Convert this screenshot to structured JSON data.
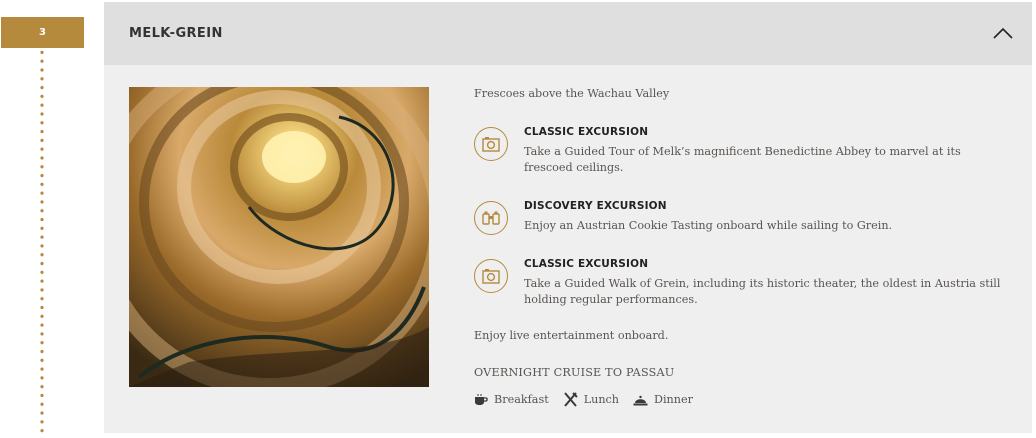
{
  "timeline": {
    "day_number": "3"
  },
  "card": {
    "title": "MELK-GREIN",
    "intro": "Frescoes above the Wachau Valley",
    "excursions": [
      {
        "type": "CLASSIC EXCURSION",
        "icon": "camera-icon",
        "description": "Take a Guided Tour of Melk’s magnificent Benedictine Abbey to marvel at its frescoed ceilings."
      },
      {
        "type": "DISCOVERY EXCURSION",
        "icon": "binoculars-icon",
        "description": "Enjoy an Austrian Cookie Tasting onboard while sailing to Grein."
      },
      {
        "type": "CLASSIC EXCURSION",
        "icon": "camera-icon",
        "description": "Take a Guided Walk of Grein, including its historic theater, the oldest in Austria still holding regular performances."
      }
    ],
    "entertainment": "Enjoy live entertainment onboard.",
    "overnight": "OVERNIGHT CRUISE TO PASSAU",
    "meals": [
      {
        "label": "Breakfast",
        "icon": "coffee-cup-icon"
      },
      {
        "label": "Lunch",
        "icon": "fork-knife-icon"
      },
      {
        "label": "Dinner",
        "icon": "cloche-icon"
      }
    ]
  },
  "colors": {
    "accent": "#b58a3c",
    "header_bg": "#dfdfdf",
    "card_bg": "#efefef"
  }
}
